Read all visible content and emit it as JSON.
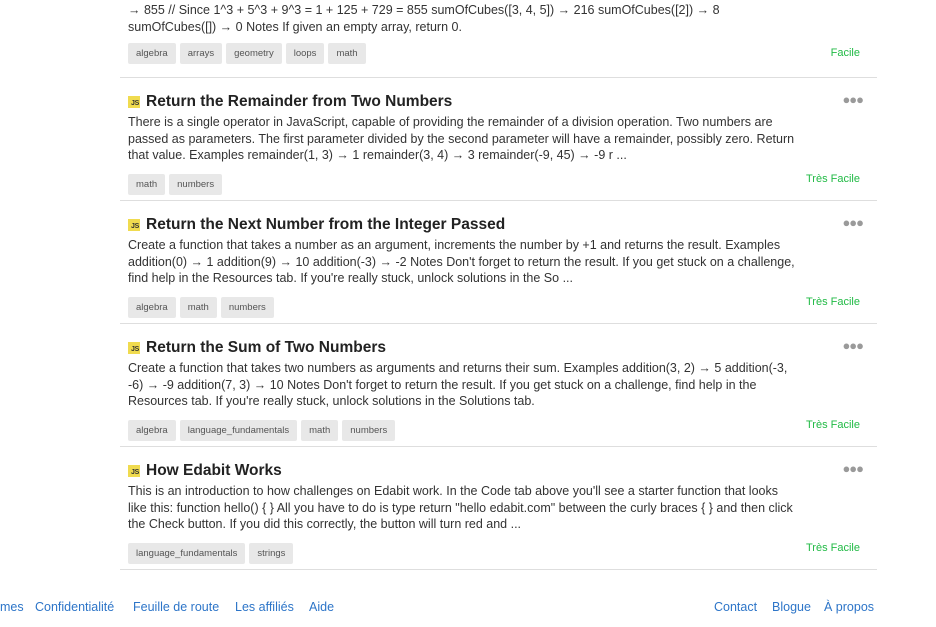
{
  "challenges": [
    {
      "description": "→ 855 // Since 1^3 + 5^3 + 9^3 = 1 + 125 + 729 = 855 sumOfCubes([3, 4, 5]) → 216 sumOfCubes([2]) → 8 sumOfCubes([]) → 0 Notes If given an empty array, return 0.",
      "tags": [
        "algebra",
        "arrays",
        "geometry",
        "loops",
        "math"
      ],
      "difficulty": "Facile"
    },
    {
      "title": "Return the Remainder from Two Numbers",
      "description": "There is a single operator in JavaScript, capable of providing the remainder of a division operation. Two numbers are passed as parameters. The first parameter divided by the second parameter will have a remainder, possibly zero. Return that value. Examples remainder(1, 3) → 1 remainder(3, 4) → 3 remainder(-9, 45) → -9 r ...",
      "tags": [
        "math",
        "numbers"
      ],
      "difficulty": "Très Facile"
    },
    {
      "title": "Return the Next Number from the Integer Passed",
      "description": "Create a function that takes a number as an argument, increments the number by +1 and returns the result. Examples addition(0) → 1 addition(9) → 10 addition(-3) → -2 Notes Don't forget to return the result. If you get stuck on a challenge, find help in the Resources tab. If you're really stuck, unlock solutions in the So ...",
      "tags": [
        "algebra",
        "math",
        "numbers"
      ],
      "difficulty": "Très Facile"
    },
    {
      "title": "Return the Sum of Two Numbers",
      "description": "Create a function that takes two numbers as arguments and returns their sum. Examples addition(3, 2) → 5 addition(-3, -6) → -9 addition(7, 3) → 10 Notes Don't forget to return the result. If you get stuck on a challenge, find help in the Resources tab. If you're really stuck, unlock solutions in the Solutions tab.",
      "tags": [
        "algebra",
        "language_fundamentals",
        "math",
        "numbers"
      ],
      "difficulty": "Très Facile"
    },
    {
      "title": "How Edabit Works",
      "description": "This is an introduction to how challenges on Edabit work. In the Code tab above you'll see a starter function that looks like this: function hello() { } All you have to do is type return \"hello edabit.com\" between the curly braces { } and then click the Check button. If you did this correctly, the button will turn red and ...",
      "tags": [
        "language_fundamentals",
        "strings"
      ],
      "difficulty": "Très Facile"
    }
  ],
  "language_badge": "JS",
  "more_icon": "ellipsis-icon",
  "footer": {
    "left": [
      "mes",
      "Confidentialité",
      "Feuille de route",
      "Les affiliés",
      "Aide"
    ],
    "right": [
      "Contact",
      "Blogue",
      "À propos"
    ]
  },
  "colors": {
    "difficulty": "#21ba45",
    "link": "#2d75c8",
    "tag_bg": "#e8e8e8",
    "js_badge": "#f0db4f"
  }
}
